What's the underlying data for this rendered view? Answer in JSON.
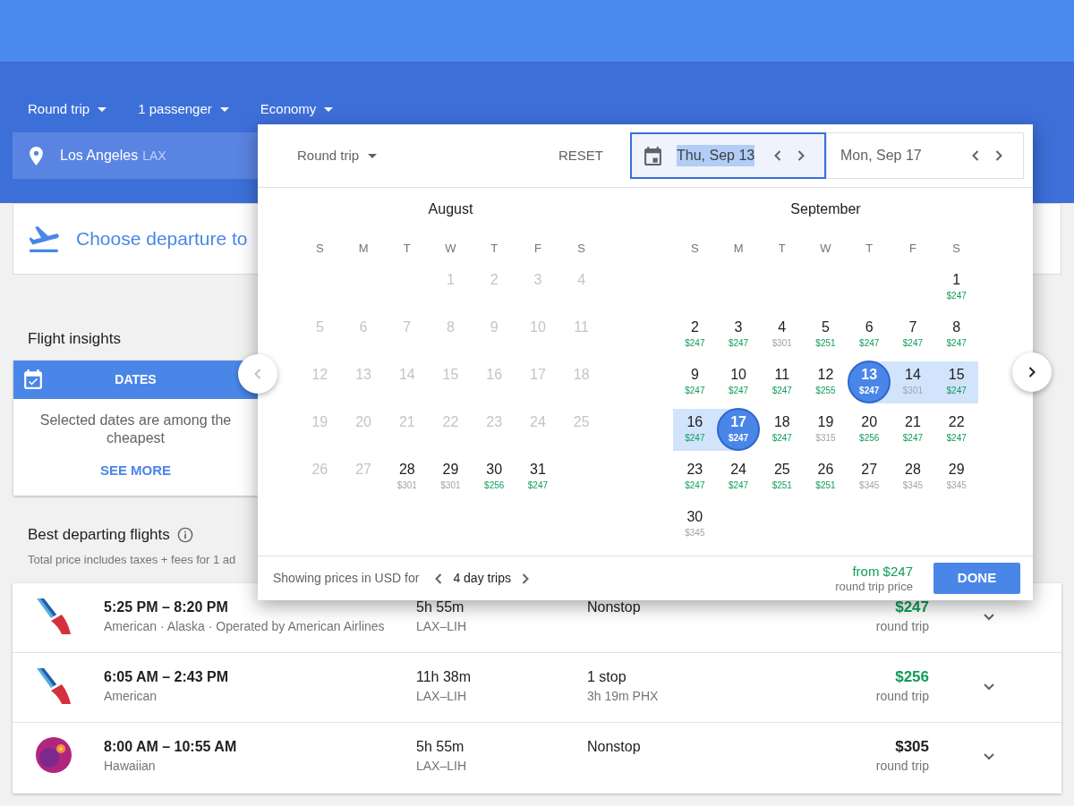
{
  "filters": [
    {
      "label": "Round trip"
    },
    {
      "label": "1 passenger"
    },
    {
      "label": "Economy"
    }
  ],
  "origin": {
    "city": "Los Angeles",
    "code": "LAX"
  },
  "destination": {
    "prompt": "Choose departure to"
  },
  "date_picker": {
    "trip_type": "Round trip",
    "reset": "RESET",
    "dates": [
      {
        "text": "Thu, Sep 13",
        "selected": true
      },
      {
        "text": "Mon, Sep 17",
        "selected": false
      }
    ],
    "nav": [
      {
        "kind": "prev",
        "disabled": true
      },
      {
        "kind": "next",
        "disabled": false
      }
    ],
    "months": [
      {
        "name": "August",
        "weekdays": [
          "S",
          "M",
          "T",
          "W",
          "T",
          "F",
          "S"
        ],
        "weeks": [
          {
            "kind": "first",
            "days": [
              {
                "day": "1",
                "disabled": true,
                "selected": false,
                "in_range": false
              },
              {
                "day": "2",
                "disabled": true,
                "selected": false,
                "in_range": false
              },
              {
                "day": "3",
                "disabled": true,
                "selected": false,
                "in_range": false
              },
              {
                "day": "4",
                "disabled": true,
                "selected": false,
                "in_range": false
              }
            ]
          },
          {
            "kind": "regular",
            "days": [
              {
                "day": "5",
                "disabled": true,
                "selected": false,
                "in_range": false
              },
              {
                "day": "6",
                "disabled": true,
                "selected": false,
                "in_range": false
              },
              {
                "day": "7",
                "disabled": true,
                "selected": false,
                "in_range": false
              },
              {
                "day": "8",
                "disabled": true,
                "selected": false,
                "in_range": false
              },
              {
                "day": "9",
                "disabled": true,
                "selected": false,
                "in_range": false
              },
              {
                "day": "10",
                "disabled": true,
                "selected": false,
                "in_range": false
              },
              {
                "day": "11",
                "disabled": true,
                "selected": false,
                "in_range": false
              }
            ]
          },
          {
            "kind": "regular",
            "days": [
              {
                "day": "12",
                "disabled": true,
                "selected": false,
                "in_range": false
              },
              {
                "day": "13",
                "disabled": true,
                "selected": false,
                "in_range": false
              },
              {
                "day": "14",
                "disabled": true,
                "selected": false,
                "in_range": false
              },
              {
                "day": "15",
                "disabled": true,
                "selected": false,
                "in_range": false
              },
              {
                "day": "16",
                "disabled": true,
                "selected": false,
                "in_range": false
              },
              {
                "day": "17",
                "disabled": true,
                "selected": false,
                "in_range": false
              },
              {
                "day": "18",
                "disabled": true,
                "selected": false,
                "in_range": false
              }
            ]
          },
          {
            "kind": "regular",
            "days": [
              {
                "day": "19",
                "disabled": true,
                "selected": false,
                "in_range": false
              },
              {
                "day": "20",
                "disabled": true,
                "selected": false,
                "in_range": false
              },
              {
                "day": "21",
                "disabled": true,
                "selected": false,
                "in_range": false
              },
              {
                "day": "22",
                "disabled": true,
                "selected": false,
                "in_range": false
              },
              {
                "day": "23",
                "disabled": true,
                "selected": false,
                "in_range": false
              },
              {
                "day": "24",
                "disabled": true,
                "selected": false,
                "in_range": false
              },
              {
                "day": "25",
                "disabled": true,
                "selected": false,
                "in_range": false
              }
            ]
          },
          {
            "kind": "regular",
            "days": [
              {
                "day": "26",
                "disabled": true,
                "selected": false,
                "in_range": false
              },
              {
                "day": "27",
                "disabled": true,
                "selected": false,
                "in_range": false
              },
              {
                "day": "28",
                "disabled": false,
                "selected": false,
                "in_range": false,
                "price": {
                  "text": "$301",
                  "cheap": false
                }
              },
              {
                "day": "29",
                "disabled": false,
                "selected": false,
                "in_range": false,
                "price": {
                  "text": "$301",
                  "cheap": false
                }
              },
              {
                "day": "30",
                "disabled": false,
                "selected": false,
                "in_range": false,
                "price": {
                  "text": "$256",
                  "cheap": true
                }
              },
              {
                "day": "31",
                "disabled": false,
                "selected": false,
                "in_range": false,
                "price": {
                  "text": "$247",
                  "cheap": true
                }
              }
            ]
          }
        ]
      },
      {
        "name": "September",
        "weekdays": [
          "S",
          "M",
          "T",
          "W",
          "T",
          "F",
          "S"
        ],
        "weeks": [
          {
            "kind": "first",
            "days": [
              {
                "day": "1",
                "disabled": false,
                "selected": false,
                "in_range": false,
                "price": {
                  "text": "$247",
                  "cheap": true
                }
              }
            ]
          },
          {
            "kind": "regular",
            "days": [
              {
                "day": "2",
                "disabled": false,
                "selected": false,
                "in_range": false,
                "price": {
                  "text": "$247",
                  "cheap": true
                }
              },
              {
                "day": "3",
                "disabled": false,
                "selected": false,
                "in_range": false,
                "price": {
                  "text": "$247",
                  "cheap": true
                }
              },
              {
                "day": "4",
                "disabled": false,
                "selected": false,
                "in_range": false,
                "price": {
                  "text": "$301",
                  "cheap": false
                }
              },
              {
                "day": "5",
                "disabled": false,
                "selected": false,
                "in_range": false,
                "price": {
                  "text": "$251",
                  "cheap": true
                }
              },
              {
                "day": "6",
                "disabled": false,
                "selected": false,
                "in_range": false,
                "price": {
                  "text": "$247",
                  "cheap": true
                }
              },
              {
                "day": "7",
                "disabled": false,
                "selected": false,
                "in_range": false,
                "price": {
                  "text": "$247",
                  "cheap": true
                }
              },
              {
                "day": "8",
                "disabled": false,
                "selected": false,
                "in_range": false,
                "price": {
                  "text": "$247",
                  "cheap": true
                }
              }
            ]
          },
          {
            "kind": "regular",
            "days": [
              {
                "day": "9",
                "disabled": false,
                "selected": false,
                "in_range": false,
                "price": {
                  "text": "$247",
                  "cheap": true
                }
              },
              {
                "day": "10",
                "disabled": false,
                "selected": false,
                "in_range": false,
                "price": {
                  "text": "$247",
                  "cheap": true
                }
              },
              {
                "day": "11",
                "disabled": false,
                "selected": false,
                "in_range": false,
                "price": {
                  "text": "$247",
                  "cheap": true
                }
              },
              {
                "day": "12",
                "disabled": false,
                "selected": false,
                "in_range": false,
                "price": {
                  "text": "$255",
                  "cheap": true
                }
              },
              {
                "day": "13",
                "disabled": false,
                "selected": true,
                "in_range": false,
                "price": {
                  "text": "$247",
                  "cheap": true
                }
              },
              {
                "day": "14",
                "disabled": false,
                "selected": false,
                "in_range": true,
                "price": {
                  "text": "$301",
                  "cheap": false
                }
              },
              {
                "day": "15",
                "disabled": false,
                "selected": false,
                "in_range": true,
                "price": {
                  "text": "$247",
                  "cheap": true
                }
              }
            ]
          },
          {
            "kind": "regular",
            "days": [
              {
                "day": "16",
                "disabled": false,
                "selected": false,
                "in_range": true,
                "price": {
                  "text": "$247",
                  "cheap": true
                }
              },
              {
                "day": "17",
                "disabled": false,
                "selected": true,
                "in_range": false,
                "price": {
                  "text": "$247",
                  "cheap": true
                }
              },
              {
                "day": "18",
                "disabled": false,
                "selected": false,
                "in_range": false,
                "price": {
                  "text": "$247",
                  "cheap": true
                }
              },
              {
                "day": "19",
                "disabled": false,
                "selected": false,
                "in_range": false,
                "price": {
                  "text": "$315",
                  "cheap": false
                }
              },
              {
                "day": "20",
                "disabled": false,
                "selected": false,
                "in_range": false,
                "price": {
                  "text": "$256",
                  "cheap": true
                }
              },
              {
                "day": "21",
                "disabled": false,
                "selected": false,
                "in_range": false,
                "price": {
                  "text": "$247",
                  "cheap": true
                }
              },
              {
                "day": "22",
                "disabled": false,
                "selected": false,
                "in_range": false,
                "price": {
                  "text": "$247",
                  "cheap": true
                }
              }
            ]
          },
          {
            "kind": "regular",
            "days": [
              {
                "day": "23",
                "disabled": false,
                "selected": false,
                "in_range": false,
                "price": {
                  "text": "$247",
                  "cheap": true
                }
              },
              {
                "day": "24",
                "disabled": false,
                "selected": false,
                "in_range": false,
                "price": {
                  "text": "$247",
                  "cheap": true
                }
              },
              {
                "day": "25",
                "disabled": false,
                "selected": false,
                "in_range": false,
                "price": {
                  "text": "$251",
                  "cheap": true
                }
              },
              {
                "day": "26",
                "disabled": false,
                "selected": false,
                "in_range": false,
                "price": {
                  "text": "$251",
                  "cheap": true
                }
              },
              {
                "day": "27",
                "disabled": false,
                "selected": false,
                "in_range": false,
                "price": {
                  "text": "$345",
                  "cheap": false
                }
              },
              {
                "day": "28",
                "disabled": false,
                "selected": false,
                "in_range": false,
                "price": {
                  "text": "$345",
                  "cheap": false
                }
              },
              {
                "day": "29",
                "disabled": false,
                "selected": false,
                "in_range": false,
                "price": {
                  "text": "$345",
                  "cheap": false
                }
              }
            ]
          },
          {
            "kind": "regular",
            "days": [
              {
                "day": "30",
                "disabled": false,
                "selected": false,
                "in_range": false,
                "price": {
                  "text": "$345",
                  "cheap": false
                }
              }
            ]
          }
        ]
      }
    ],
    "footer": {
      "label": "Showing prices in USD for",
      "trip_length": "4 day trips",
      "from_price": "from $247",
      "price_note": "round trip price",
      "done": "DONE"
    }
  },
  "insights": {
    "title": "Flight insights",
    "tab": "DATES",
    "message": "Selected dates are among the cheapest",
    "link": "SEE MORE"
  },
  "flights": {
    "title": "Best departing flights",
    "note": "Total price includes taxes + fees for 1 ad",
    "rows": [
      {
        "kind": "tail",
        "times": "5:25 PM – 8:20 PM",
        "airlines": "American · Alaska · Operated by American Airlines",
        "duration": "5h 55m",
        "route": "LAX–LIH",
        "stops": "Nonstop",
        "price": "$247",
        "cheap": true,
        "price_note": "round trip"
      },
      {
        "kind": "tail",
        "times": "6:05 AM – 2:43 PM",
        "airlines": "American",
        "duration": "11h 38m",
        "route": "LAX–LIH",
        "stops": "1 stop",
        "layover": "3h 19m PHX",
        "price": "$256",
        "cheap": true,
        "price_note": "round trip"
      },
      {
        "kind": "circle",
        "times": "8:00 AM – 10:55 AM",
        "airlines": "Hawaiian",
        "duration": "5h 55m",
        "route": "LAX–LIH",
        "stops": "Nonstop",
        "price": "$305",
        "cheap": false,
        "price_note": "round trip"
      }
    ]
  }
}
